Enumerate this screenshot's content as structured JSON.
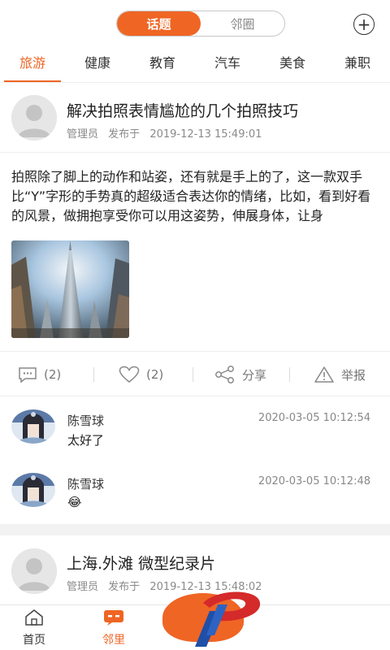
{
  "header": {
    "tabs": [
      {
        "label": "话题",
        "active": true
      },
      {
        "label": "邻圈",
        "active": false
      }
    ],
    "add_icon": "plus-circle-icon"
  },
  "categories": [
    "旅游",
    "健康",
    "教育",
    "汽车",
    "美食",
    "兼职"
  ],
  "active_category": "旅游",
  "post": {
    "title": "解决拍照表情尴尬的几个拍照技巧",
    "author": "管理员",
    "published_label": "发布于",
    "published_at": "2019-12-13 15:49:01",
    "body": "拍照除了脚上的动作和站姿，还有就是手上的了，这一款双手比“Y”字形的手势真的超级适合表达你的情绪，比如，看到好看的风景，做拥抱享受你可以用这姿势，伸展身体，让身",
    "comment_count": "(2)",
    "like_count": "(2)",
    "share_label": "分享",
    "report_label": "举报"
  },
  "comments": [
    {
      "name": "陈雪球",
      "time": "2020-03-05 10:12:54",
      "text": "太好了"
    },
    {
      "name": "陈雪球",
      "time": "2020-03-05 10:12:48",
      "text": "😂"
    }
  ],
  "next_post": {
    "title": "上海.外滩 微型纪录片",
    "author": "管理员",
    "published_label": "发布于",
    "published_at": "2019-12-13 15:48:02"
  },
  "bottom_nav": {
    "items": [
      {
        "label": "首页",
        "icon": "home-icon",
        "active": false
      },
      {
        "label": "邻里",
        "icon": "chat-icon",
        "active": true
      }
    ]
  },
  "colors": {
    "accent": "#ef6524",
    "muted": "#8a8a8a"
  }
}
